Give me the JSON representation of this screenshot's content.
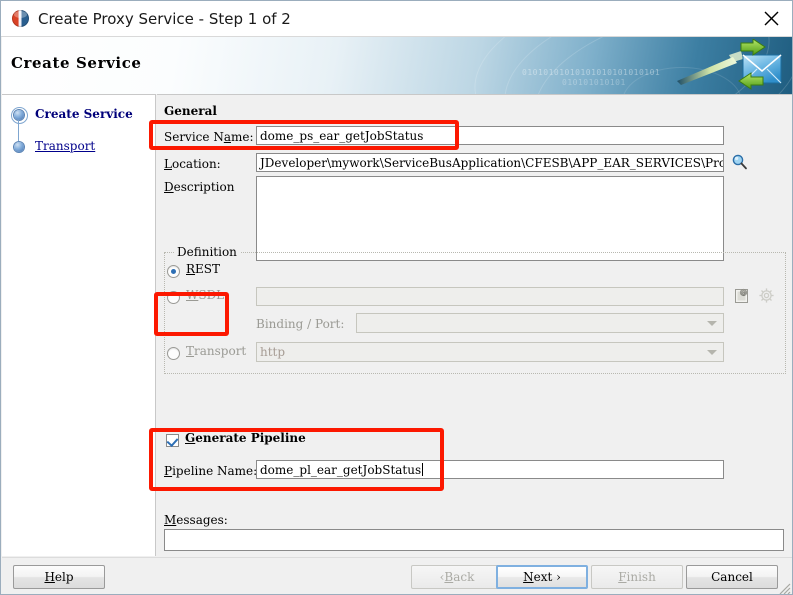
{
  "window": {
    "title": "Create Proxy Service - Step 1 of 2",
    "app_icon": "oracle-jdeveloper-icon",
    "close_label": "✕"
  },
  "banner": {
    "heading": "Create Service",
    "bits_line1": "01010101010101010101010101",
    "bits_line2": "010101010101",
    "art_icon": "envelope-with-arrows-icon"
  },
  "sidebar": {
    "items": [
      {
        "label": "Create Service",
        "state": "current"
      },
      {
        "label": "Transport",
        "state": "link"
      }
    ]
  },
  "general": {
    "section_title": "General",
    "service_name": {
      "label_pre": "Service N",
      "label_mn": "a",
      "label_post": "me:",
      "value": "dome_ps_ear_getJobStatus"
    },
    "location": {
      "label_mn": "L",
      "label_post": "ocation:",
      "value": "JDeveloper\\mywork\\ServiceBusApplication\\CFESB\\APP_EAR_SERVICES\\Proxy_Services",
      "browse_icon": "magnifier-icon"
    },
    "description": {
      "label_mn": "D",
      "label_post": "escription",
      "value": ""
    }
  },
  "definition": {
    "group_title": "Definition",
    "selected": "REST",
    "options": [
      {
        "id": "rest",
        "label_mn": "R",
        "label_post": "EST",
        "checked": true
      },
      {
        "id": "wsdl",
        "label_mn": "W",
        "label_post": "SDL:",
        "checked": false,
        "value": ""
      },
      {
        "id": "transport",
        "label_mn": "T",
        "label_post": "ransport",
        "checked": false,
        "value": "http"
      }
    ],
    "binding_port": {
      "label": "Binding / Port:",
      "value": ""
    },
    "wsdl_browse_icon": "browse-document-icon",
    "wsdl_gear_icon": "gear-icon"
  },
  "pipeline": {
    "checkbox_label_mn": "G",
    "checkbox_label_post": "enerate Pipeline",
    "checked": true,
    "name_label_mn": "P",
    "name_label_post": "ipeline Name:",
    "name_value": "dome_pl_ear_getJobStatus"
  },
  "messages": {
    "label_mn": "M",
    "label_post": "essages:",
    "value": ""
  },
  "buttons": {
    "help": {
      "mn": "H",
      "post": "elp",
      "disabled": false
    },
    "back": {
      "pre": "‹ ",
      "mn": "B",
      "post": "ack",
      "disabled": true
    },
    "next": {
      "mn": "N",
      "post": "ext ›",
      "disabled": false,
      "default": true
    },
    "finish": {
      "mn": "F",
      "post": "inish",
      "disabled": true
    },
    "cancel": {
      "pre": "",
      "mn": "",
      "post": "Cancel",
      "disabled": false
    }
  },
  "annotations": {
    "color": "#fc1800",
    "boxes": [
      {
        "name": "service-name-highlight"
      },
      {
        "name": "rest-option-highlight"
      },
      {
        "name": "generate-pipeline-highlight"
      }
    ]
  }
}
